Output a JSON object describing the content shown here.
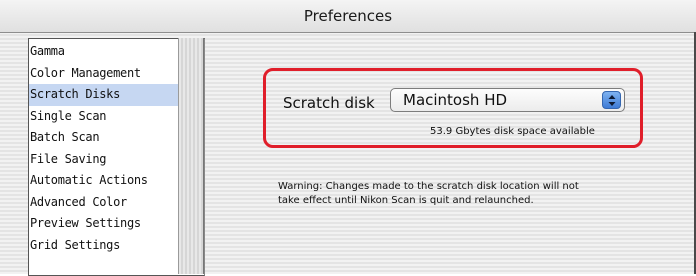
{
  "window": {
    "title": "Preferences"
  },
  "sidebar": {
    "items": [
      {
        "label": "Gamma",
        "selected": false
      },
      {
        "label": "Color Management",
        "selected": false
      },
      {
        "label": "Scratch Disks",
        "selected": true
      },
      {
        "label": "Single Scan",
        "selected": false
      },
      {
        "label": "Batch Scan",
        "selected": false
      },
      {
        "label": "File Saving",
        "selected": false
      },
      {
        "label": "Automatic Actions",
        "selected": false
      },
      {
        "label": "Advanced Color",
        "selected": false
      },
      {
        "label": "Preview Settings",
        "selected": false
      },
      {
        "label": "Grid Settings",
        "selected": false
      }
    ],
    "selected_color": "#c6d7f2"
  },
  "scratch": {
    "label": "Scratch disk",
    "selected_disk": "Macintosh HD",
    "space_available": "53.9 Gbytes disk space available",
    "highlight_color": "#e01e2a",
    "popup_icon": "up-down-arrows-icon"
  },
  "warning": {
    "line1": "Warning: Changes made to the scratch disk location will not",
    "line2": "take effect until Nikon Scan is quit and relaunched."
  }
}
